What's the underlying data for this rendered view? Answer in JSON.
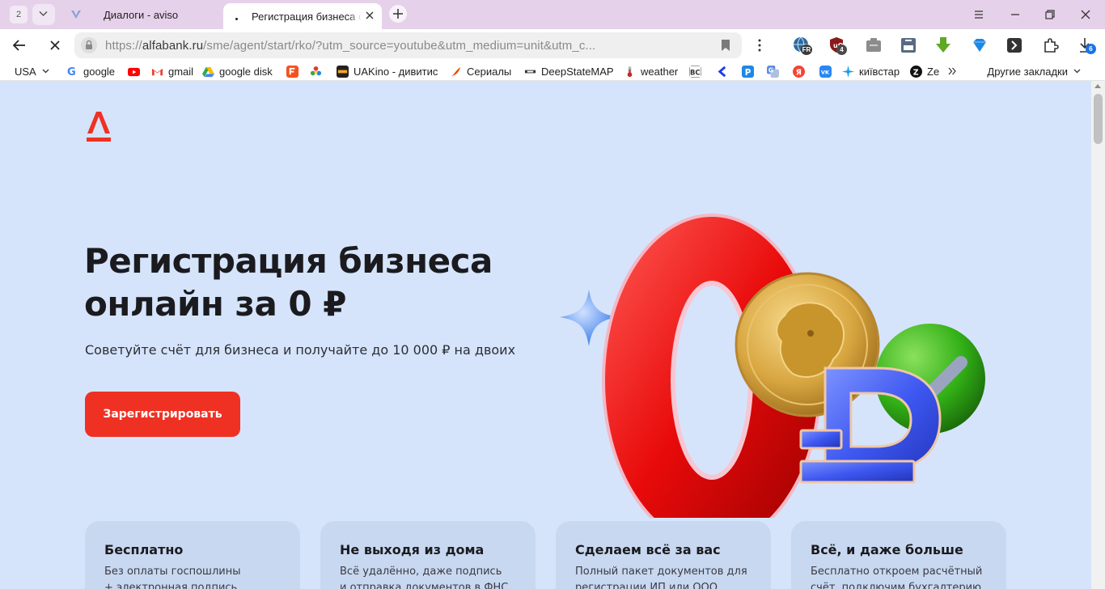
{
  "browser": {
    "tab_count": "2",
    "tabs": [
      {
        "title": "Диалоги - aviso"
      },
      {
        "title": "Регистрация бизнеса онлайн"
      }
    ],
    "address": {
      "scheme": "https://",
      "host": "alfabank.ru",
      "path": "/sme/agent/start/rko/?utm_source=youtube&utm_medium=unit&utm_c..."
    },
    "extensions": [
      {
        "icon": "vpn-globe-icon",
        "badge": "FR"
      },
      {
        "icon": "ublock-icon",
        "badge": "4"
      },
      {
        "icon": "extension-box-icon"
      },
      {
        "icon": "media-extension-icon"
      },
      {
        "icon": "download-arrow-icon"
      },
      {
        "icon": "diamond-icon"
      },
      {
        "icon": "bookmark-script-icon"
      },
      {
        "icon": "puzzle-icon"
      },
      {
        "icon": "downloads-icon",
        "badge": "6"
      }
    ],
    "bookmarks": [
      {
        "label": "USA",
        "icon": "folder-dropdown-icon"
      },
      {
        "label": "google",
        "icon": "google-icon",
        "color": "#4285f4"
      },
      {
        "label": "",
        "icon": "youtube-icon",
        "color": "#ff0000"
      },
      {
        "label": "gmail",
        "icon": "gmail-icon",
        "color": "#ea4335"
      },
      {
        "label": "google disk",
        "icon": "google-drive-icon",
        "color": "#34a853"
      },
      {
        "label": "",
        "icon": "f-icon",
        "color": "#f4511e"
      },
      {
        "label": "",
        "icon": "flower-icon",
        "color": "#43a047"
      },
      {
        "label": "UAKino - дивитис",
        "icon": "uakino-icon",
        "color": "#222222"
      },
      {
        "label": "Сериалы",
        "icon": "fox-icon",
        "color": "#e65100"
      },
      {
        "label": "DeepStateMAP",
        "icon": "deepstate-icon",
        "color": "#333333"
      },
      {
        "label": "weather",
        "icon": "thermometer-icon",
        "color": "#c62828"
      },
      {
        "label": "",
        "icon": "bc-icon",
        "color": "#333333"
      },
      {
        "label": "",
        "icon": "arrow-left-icon",
        "color": "#1e3de4"
      },
      {
        "label": "",
        "icon": "p-icon",
        "color": "#1e88e5"
      },
      {
        "label": "",
        "icon": "translate-icon",
        "color": "#5c8de6"
      },
      {
        "label": "",
        "icon": "yandex-icon",
        "color": "#f44336"
      },
      {
        "label": "",
        "icon": "vk-icon",
        "color": "#2787f5"
      },
      {
        "label": "київстар",
        "icon": "kyivstar-icon",
        "color": "#1e9be9"
      },
      {
        "label": "Ze",
        "icon": "z-icon",
        "color": "#111111"
      }
    ],
    "other_bookmarks": "Другие закладки"
  },
  "page": {
    "hero": {
      "title_line1": "Регистрация бизнеса",
      "title_line2": "онлайн за 0 ₽",
      "subtitle": "Советуйте счёт для бизнеса и получайте до 10 000 ₽ на двоих",
      "cta": "Зарегистрировать"
    },
    "features": [
      {
        "title": "Бесплатно",
        "line1": "Без оплаты госпошлины",
        "line2": "+ электронная подпись"
      },
      {
        "title": "Не выходя из дома",
        "line1": "Всё удалённо, даже подпись",
        "line2": "и отправка документов в ФНС"
      },
      {
        "title": "Сделаем всё за вас",
        "line1": "Полный пакет документов для",
        "line2": "регистрации ИП или ООО"
      },
      {
        "title": "Всё, и даже больше",
        "line1": "Бесплатно откроем расчётный",
        "line2": "счёт, подключим бухгалтерию"
      }
    ],
    "colors": {
      "brand_red": "#ef3124",
      "page_bg": "#d5e4fb",
      "card_bg": "#c8d8f0"
    }
  }
}
